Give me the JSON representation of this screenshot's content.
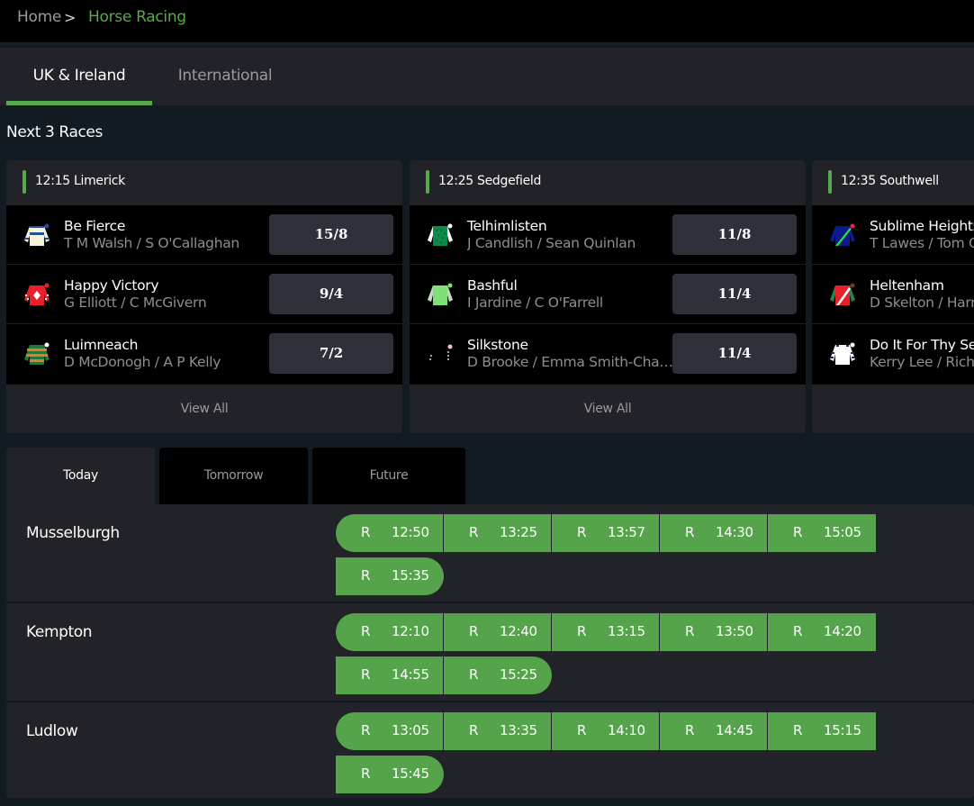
{
  "breadcrumb": {
    "home": "Home",
    "separator": ">",
    "current": "Horse Racing"
  },
  "region_tabs": [
    {
      "label": "UK & Ireland",
      "active": true
    },
    {
      "label": "International",
      "active": false
    }
  ],
  "next_races": {
    "title": "Next 3 Races",
    "view_all_label": "View All",
    "cards": [
      {
        "title": "12:15 Limerick",
        "runners": [
          {
            "name": "Be Fierce",
            "people": "T M Walsh / S O'Callaghan",
            "odds": "15/8",
            "silk": "cream-blue-hoops-icon"
          },
          {
            "name": "Happy Victory",
            "people": "G Elliott / C McGivern",
            "odds": "9/4",
            "silk": "red-white-diamond-icon"
          },
          {
            "name": "Luimneach",
            "people": "D McDonogh / A P Kelly",
            "odds": "7/2",
            "silk": "green-orange-hoops-icon"
          }
        ]
      },
      {
        "title": "12:25 Sedgefield",
        "runners": [
          {
            "name": "Telhimlisten",
            "people": "J Candlish / Sean Quinlan",
            "odds": "11/8",
            "silk": "green-spots-icon"
          },
          {
            "name": "Bashful",
            "people": "I Jardine / C O'Farrell",
            "odds": "11/4",
            "silk": "light-green-icon"
          },
          {
            "name": "Silkstone",
            "people": "D Brooke / Emma Smith-Chaston",
            "odds": "11/4",
            "silk": "dotted-outline-icon"
          }
        ]
      },
      {
        "title": "12:35 Southwell",
        "runners": [
          {
            "name": "Sublime Heights",
            "people": "T Lawes / Tom C",
            "odds": "",
            "silk": "navy-green-sash-icon"
          },
          {
            "name": "Heltenham",
            "people": "D Skelton / Harr",
            "odds": "",
            "silk": "red-white-sash-icon"
          },
          {
            "name": "Do It For Thy Se",
            "people": "Kerry Lee / Rich",
            "odds": "",
            "silk": "white-navy-sleeves-icon"
          }
        ]
      }
    ]
  },
  "day_tabs": [
    {
      "label": "Today",
      "active": true
    },
    {
      "label": "Tomorrow",
      "active": false
    },
    {
      "label": "Future",
      "active": false
    }
  ],
  "meetings": [
    {
      "name": "Musselburgh",
      "races": [
        {
          "type": "R",
          "time": "12:50"
        },
        {
          "type": "R",
          "time": "13:25"
        },
        {
          "type": "R",
          "time": "13:57"
        },
        {
          "type": "R",
          "time": "14:30"
        },
        {
          "type": "R",
          "time": "15:05"
        },
        {
          "type": "R",
          "time": "15:35"
        }
      ]
    },
    {
      "name": "Kempton",
      "races": [
        {
          "type": "R",
          "time": "12:10"
        },
        {
          "type": "R",
          "time": "12:40"
        },
        {
          "type": "R",
          "time": "13:15"
        },
        {
          "type": "R",
          "time": "13:50"
        },
        {
          "type": "R",
          "time": "14:20"
        },
        {
          "type": "R",
          "time": "14:55"
        },
        {
          "type": "R",
          "time": "15:25"
        }
      ]
    },
    {
      "name": "Ludlow",
      "races": [
        {
          "type": "R",
          "time": "13:05"
        },
        {
          "type": "R",
          "time": "13:35"
        },
        {
          "type": "R",
          "time": "14:10"
        },
        {
          "type": "R",
          "time": "14:45"
        },
        {
          "type": "R",
          "time": "15:15"
        },
        {
          "type": "R",
          "time": "15:45"
        }
      ]
    }
  ],
  "colors": {
    "accent_green": "#5aa94b",
    "race_pill_green": "#55a44b",
    "page_bg": "#121b22",
    "panel_bg": "#222328",
    "odds_bg": "#2e3139"
  }
}
